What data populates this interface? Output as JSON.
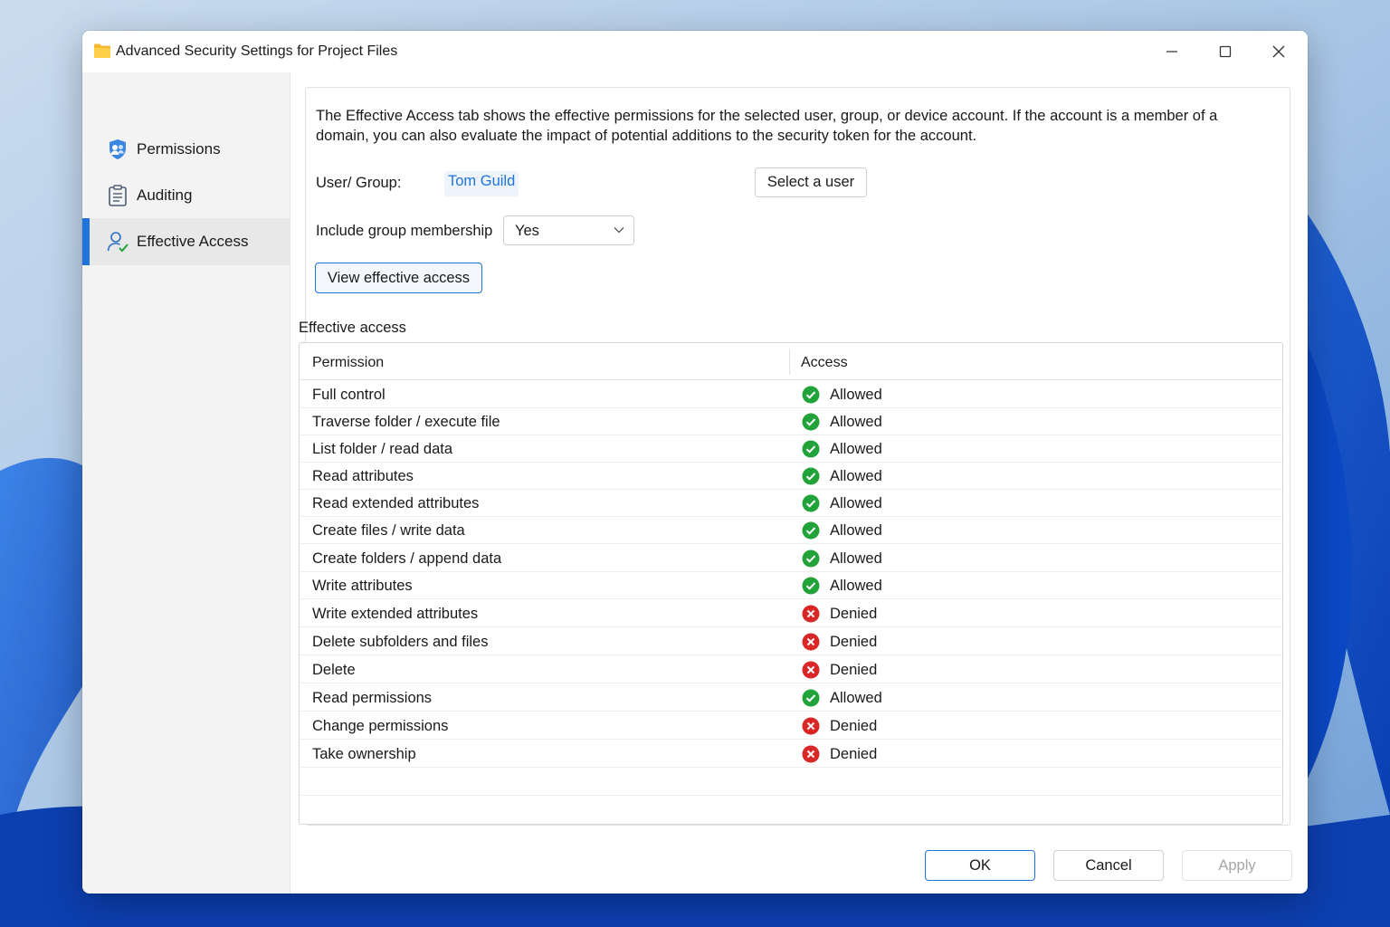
{
  "window": {
    "title": "Advanced Security Settings for Project Files"
  },
  "sidebar": {
    "items": [
      {
        "label": "Permissions",
        "icon": "shield-users-icon",
        "active": false
      },
      {
        "label": "Auditing",
        "icon": "clipboard-icon",
        "active": false
      },
      {
        "label": "Effective Access",
        "icon": "user-check-icon",
        "active": true
      }
    ]
  },
  "main": {
    "description": "The Effective Access tab shows the effective permissions for the selected user, group, or device account. If the account is a member of a domain, you can also evaluate the impact of potential additions to the security token for the account.",
    "user_group_label": "User/ Group:",
    "user_group_value": "Tom Guild",
    "select_user_label": "Select a user",
    "include_group_label": "Include group membership",
    "include_group_value": "Yes",
    "view_button_label": "View effective access",
    "section_title": "Effective access",
    "table": {
      "columns": [
        "Permission",
        "Access"
      ],
      "rows": [
        {
          "permission": "Full control",
          "access": "Allowed"
        },
        {
          "permission": "Traverse folder / execute file",
          "access": "Allowed"
        },
        {
          "permission": "List folder / read data",
          "access": "Allowed"
        },
        {
          "permission": "Read attributes",
          "access": "Allowed"
        },
        {
          "permission": "Read extended attributes",
          "access": "Allowed"
        },
        {
          "permission": "Create files / write data",
          "access": "Allowed"
        },
        {
          "permission": "Create folders / append data",
          "access": "Allowed"
        },
        {
          "permission": "Write attributes",
          "access": "Allowed"
        },
        {
          "permission": "Write extended attributes",
          "access": "Denied"
        },
        {
          "permission": "Delete subfolders and files",
          "access": "Denied"
        },
        {
          "permission": "Delete",
          "access": "Denied"
        },
        {
          "permission": "Read permissions",
          "access": "Allowed"
        },
        {
          "permission": "Change permissions",
          "access": "Denied"
        },
        {
          "permission": "Take ownership",
          "access": "Denied"
        }
      ]
    }
  },
  "footer": {
    "ok_label": "OK",
    "cancel_label": "Cancel",
    "apply_label": "Apply"
  },
  "colors": {
    "accent": "#1f73d9",
    "allowed": "#22a339",
    "denied": "#d92626"
  }
}
